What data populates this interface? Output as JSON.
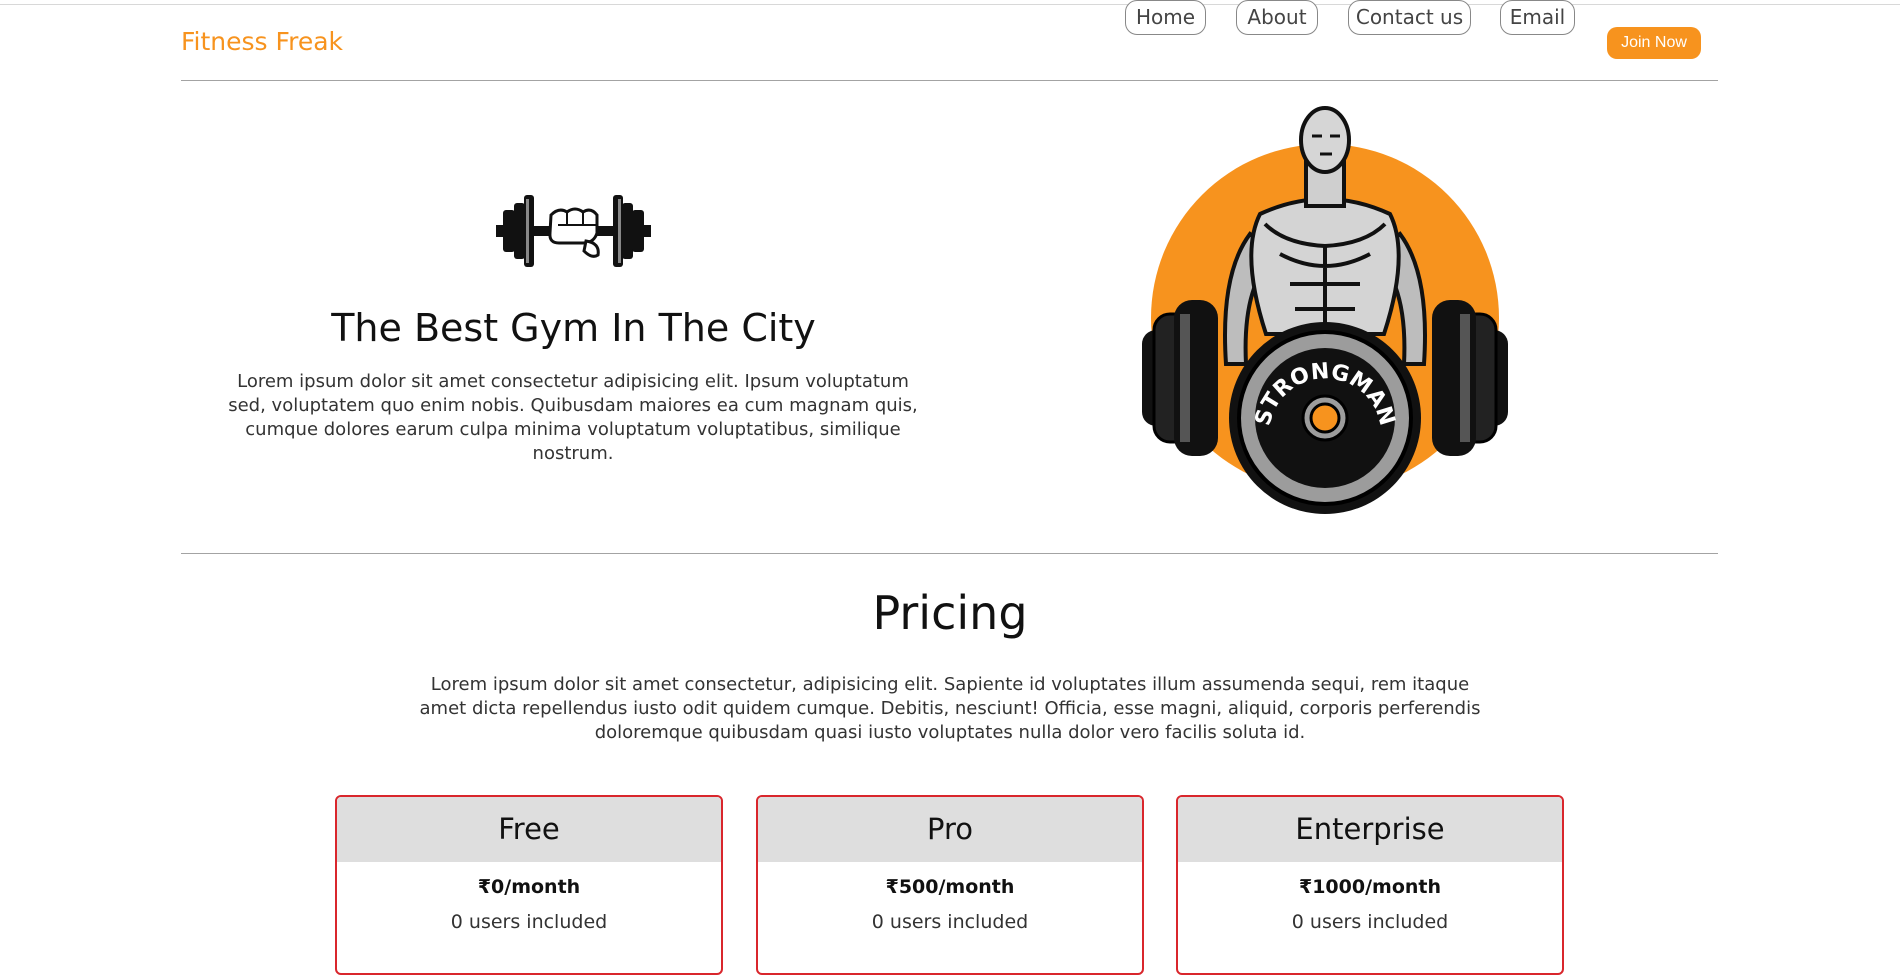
{
  "header": {
    "brand": "Fitness Freak",
    "nav": [
      "Home",
      "About",
      "Contact us",
      "Email"
    ],
    "cta": "Join Now"
  },
  "hero": {
    "title": "The Best Gym In The City",
    "text": "Lorem ipsum dolor sit amet consectetur adipisicing elit. Ipsum voluptatum sed, voluptatem quo enim nobis. Quibusdam maiores ea cum magnam quis, cumque dolores earum culpa minima voluptatum voluptatibus, similique nostrum.",
    "logo_text": "STRONGMAN"
  },
  "pricing": {
    "title": "Pricing",
    "text": "Lorem ipsum dolor sit amet consectetur, adipisicing elit. Sapiente id voluptates illum assumenda sequi, rem itaque amet dicta repellendus iusto odit quidem cumque. Debitis, nesciunt! Officia, esse magni, aliquid, corporis perferendis doloremque quibusdam quasi iusto voluptates nulla dolor vero facilis soluta id.",
    "plans": [
      {
        "name": "Free",
        "price": "₹0/month",
        "users": "0 users included"
      },
      {
        "name": "Pro",
        "price": "₹500/month",
        "users": "0 users included"
      },
      {
        "name": "Enterprise",
        "price": "₹1000/month",
        "users": "0 users included"
      }
    ]
  },
  "colors": {
    "accent": "#f7931e",
    "card_border": "#d9262c",
    "card_header": "#dedede"
  }
}
